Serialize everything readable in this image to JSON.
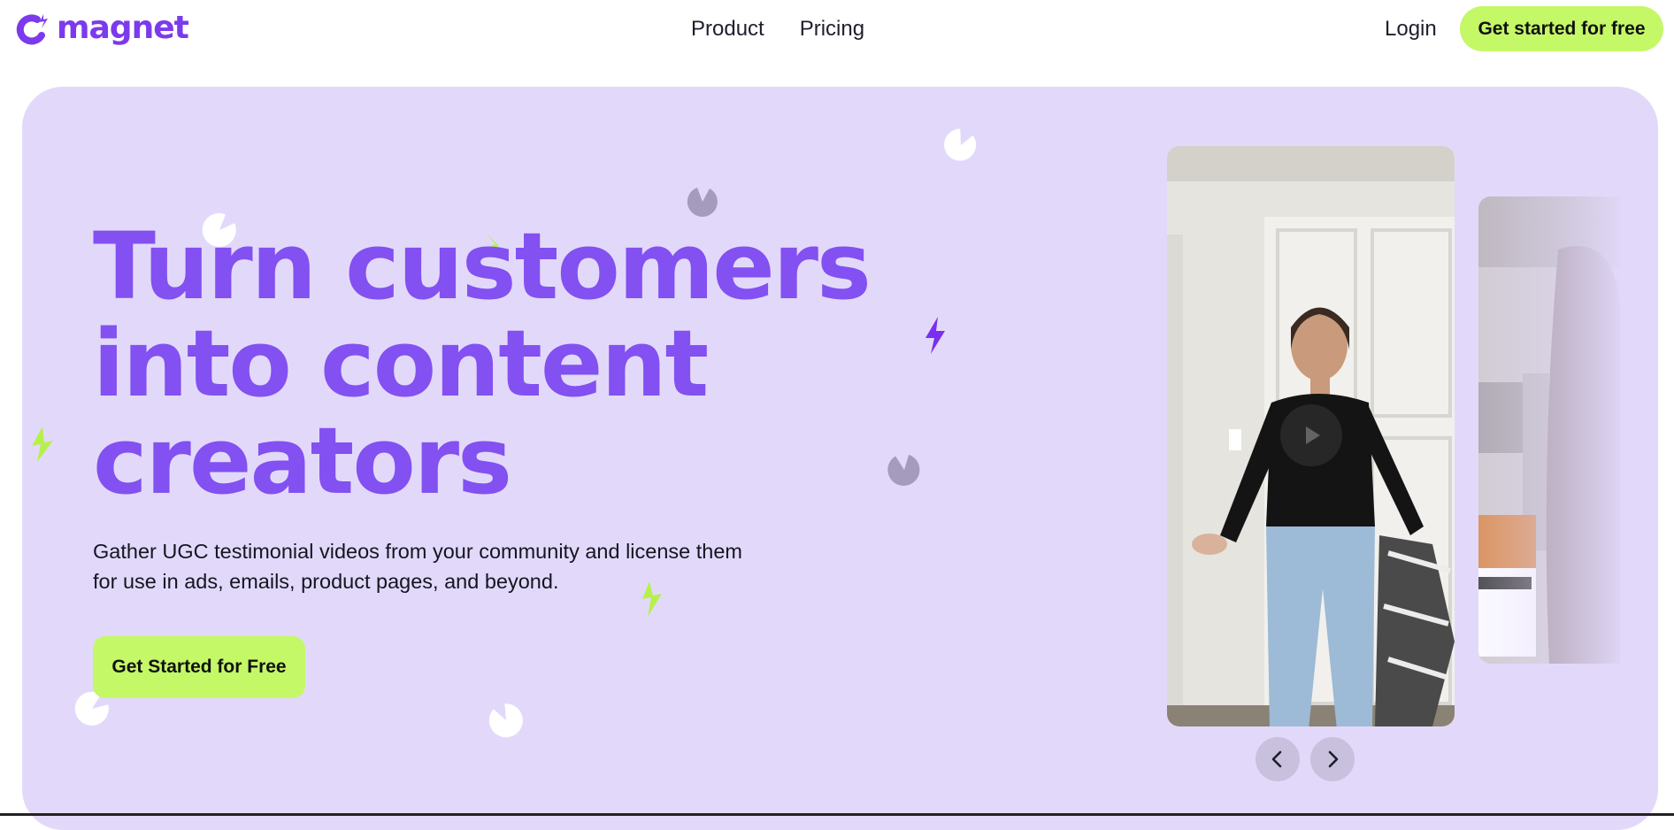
{
  "brand": {
    "name": "magnet",
    "accent": "#7c3aed",
    "cta_color": "#c4f867",
    "hero_bg": "#e2d9fa"
  },
  "nav": {
    "links": [
      "Product",
      "Pricing"
    ],
    "login_label": "Login",
    "cta_label": "Get started for free"
  },
  "hero": {
    "headline_lines": [
      "Turn customers",
      "into content",
      "creators"
    ],
    "subtext": "Gather UGC testimonial videos from your community and license them for use in ads, emails, product pages, and beyond.",
    "cta_label": "Get Started for Free"
  },
  "carousel": {
    "prev_icon": "chevron-left-icon",
    "next_icon": "chevron-right-icon",
    "play_icon": "play-icon"
  }
}
